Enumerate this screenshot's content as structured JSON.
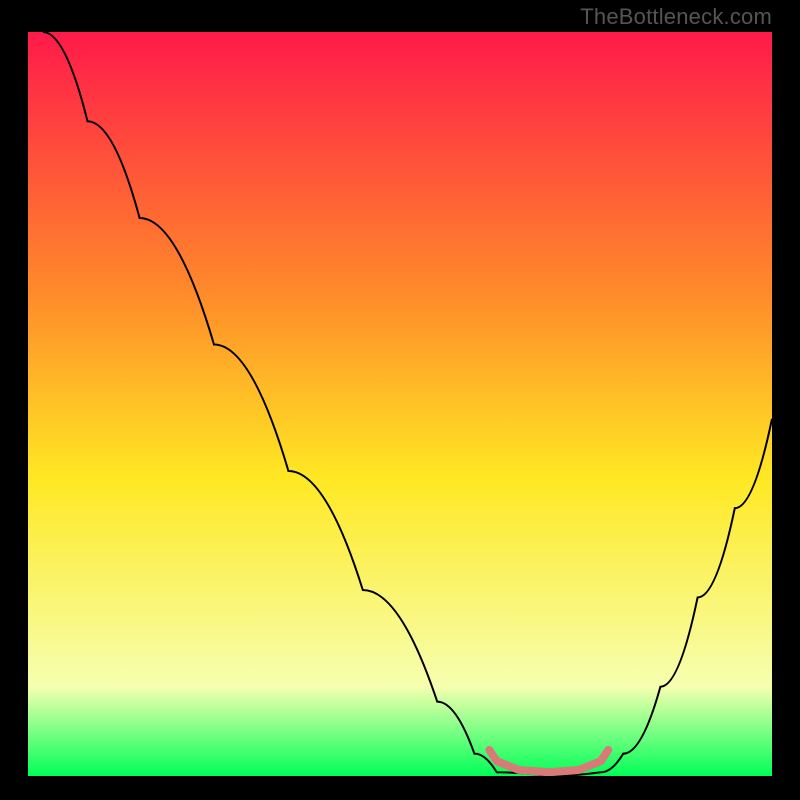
{
  "watermark": "TheBottleneck.com",
  "chart_data": {
    "type": "line",
    "title": "",
    "xlabel": "",
    "ylabel": "",
    "xlim": [
      0,
      100
    ],
    "ylim": [
      0,
      100
    ],
    "background_gradient": {
      "top": "#ff1a4a",
      "mid_upper": "#ff8a2a",
      "mid": "#ffe823",
      "lower": "#f6ffb0",
      "bottom": "#00ff58"
    },
    "series": [
      {
        "name": "bottleneck-curve",
        "stroke": "#000000",
        "stroke_width": 2,
        "points": [
          {
            "x": 2,
            "y": 100
          },
          {
            "x": 8,
            "y": 88
          },
          {
            "x": 15,
            "y": 75
          },
          {
            "x": 25,
            "y": 58
          },
          {
            "x": 35,
            "y": 41
          },
          {
            "x": 45,
            "y": 25
          },
          {
            "x": 55,
            "y": 10
          },
          {
            "x": 60,
            "y": 3
          },
          {
            "x": 63,
            "y": 0.5
          },
          {
            "x": 70,
            "y": 0
          },
          {
            "x": 77,
            "y": 0.5
          },
          {
            "x": 80,
            "y": 3
          },
          {
            "x": 85,
            "y": 12
          },
          {
            "x": 90,
            "y": 24
          },
          {
            "x": 95,
            "y": 36
          },
          {
            "x": 100,
            "y": 48
          }
        ]
      },
      {
        "name": "optimal-zone-markers",
        "stroke": "#d87a78",
        "stroke_width": 8,
        "stroke_linecap": "round",
        "points": [
          {
            "x": 62,
            "y": 3.5
          },
          {
            "x": 63,
            "y": 2
          },
          {
            "x": 66,
            "y": 0.8
          },
          {
            "x": 70,
            "y": 0.5
          },
          {
            "x": 74,
            "y": 0.8
          },
          {
            "x": 77,
            "y": 2
          },
          {
            "x": 78,
            "y": 3.5
          }
        ]
      }
    ]
  }
}
